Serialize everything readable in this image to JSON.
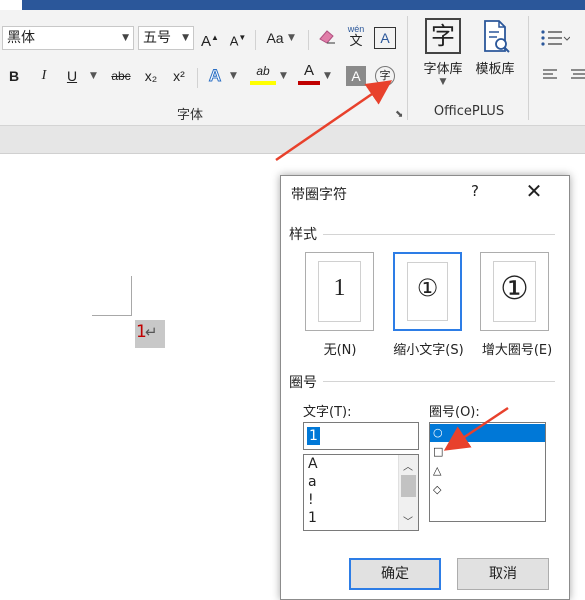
{
  "ribbon": {
    "font_name": "黑体",
    "font_size": "五号",
    "grow_font": "A",
    "shrink_font": "A",
    "change_case": "Aa",
    "clear_format_icon": "eraser-icon",
    "phonetic_guide": "wén",
    "phonetic_char": "文",
    "char_border": "A",
    "bold": "B",
    "italic": "I",
    "underline": "U",
    "strikethrough": "abc",
    "subscript": "x₂",
    "superscript": "x²",
    "text_effects": "A",
    "highlight": "ab",
    "font_color": "A",
    "char_shading": "A",
    "enclose_char": "字",
    "font_group_label": "字体",
    "officeplus_font_glyph": "字",
    "officeplus_font_lib": "字体库",
    "officeplus_template_lib": "模板库",
    "officeplus_group_label": "OfficePLUS",
    "colors": {
      "highlight": "#ffff00",
      "font_color": "#c00000",
      "accent": "#2b579a"
    }
  },
  "document": {
    "char": "1",
    "paragraph_mark": "↵"
  },
  "dialog": {
    "title": "带圈字符",
    "help": "?",
    "close": "✕",
    "style_section": "样式",
    "styles": [
      {
        "preview": "1",
        "label": "无(N)"
      },
      {
        "preview": "①",
        "label": "缩小文字(S)"
      },
      {
        "preview": "①",
        "label": "增大圈号(E)"
      }
    ],
    "enclosure_section": "圈号",
    "text_label": "文字(T):",
    "text_value": "1",
    "text_list": [
      "A",
      "a",
      "!",
      "1"
    ],
    "enclosure_label": "圈号(O):",
    "enclosure_list": [
      "○",
      "□",
      "△",
      "◇"
    ],
    "ok": "确定",
    "cancel": "取消"
  }
}
